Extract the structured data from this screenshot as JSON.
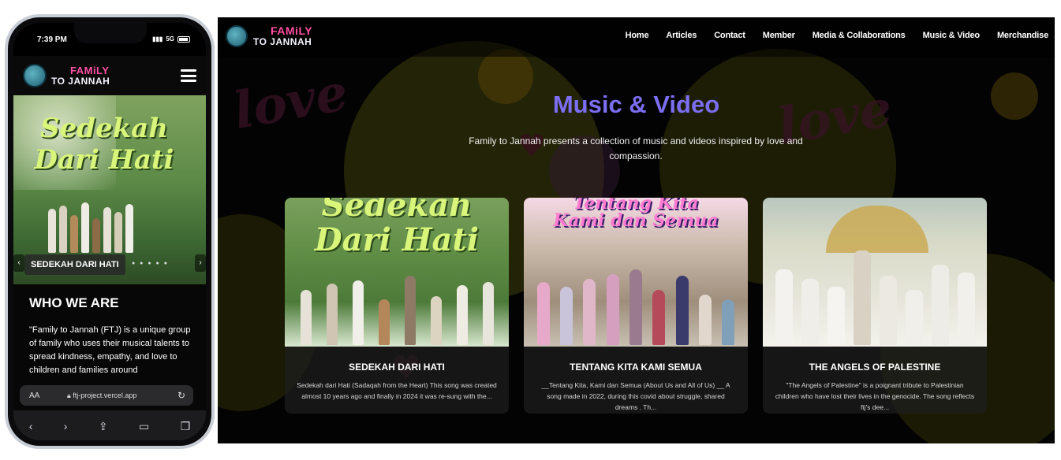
{
  "phone": {
    "status": {
      "time": "7:39 PM",
      "signal": "5G"
    },
    "logo": {
      "line1": "FAMiLY",
      "line2": "TO JANNAH"
    },
    "hero": {
      "title_line1": "Sedekah",
      "title_line2": "Dari Hati",
      "caption": "SEDEKAH DARI HATI"
    },
    "who": {
      "heading": "WHO WE ARE",
      "text": "\"Family to Jannah (FTJ) is a unique group of family who uses their musical talents to spread kindness, empathy, and love to children and families around"
    },
    "browser": {
      "aa": "AA",
      "url": "ftj-project.vercel.app"
    }
  },
  "desktop": {
    "logo": {
      "line1": "FAMiLY",
      "line2": "TO JANNAH"
    },
    "nav": [
      "Home",
      "Articles",
      "Contact",
      "Member",
      "Media & Collaborations",
      "Music & Video",
      "Merchandise"
    ],
    "title": "Music & Video",
    "subtitle": "Family to Jannah presents a collection of music and videos inspired by love and compassion.",
    "cards": [
      {
        "title": "SEDEKAH DARI HATI",
        "image_title_1": "Sedekah",
        "image_title_2": "Dari Hati",
        "desc": "Sedekah dari Hati (Sadaqah from the Heart) This song was created almost 10 years ago and finally in 2024 it was re-sung with the..."
      },
      {
        "title": "TENTANG KITA KAMI SEMUA",
        "image_title_1": "Tentang Kita",
        "image_title_2": "Kami dan Semua",
        "desc": "__Tentang Kita, Kami dan Semua (About Us and All of Us) __ A song made in 2022, during this covid about struggle, shared dreams . Th..."
      },
      {
        "title": "THE ANGELS OF PALESTINE",
        "desc": "\"The Angels of Palestine\" is a poignant tribute to Palestinian children who have lost their lives in the genocide. The song reflects ftj's dee..."
      }
    ]
  },
  "colors": {
    "accent": "#7c6ef0",
    "brand_pink": "#ff4fa3"
  },
  "icons": [
    "hamburger-icon",
    "back-icon",
    "forward-icon",
    "share-icon",
    "bookmarks-icon",
    "tabs-icon",
    "reload-icon",
    "lock-icon"
  ]
}
